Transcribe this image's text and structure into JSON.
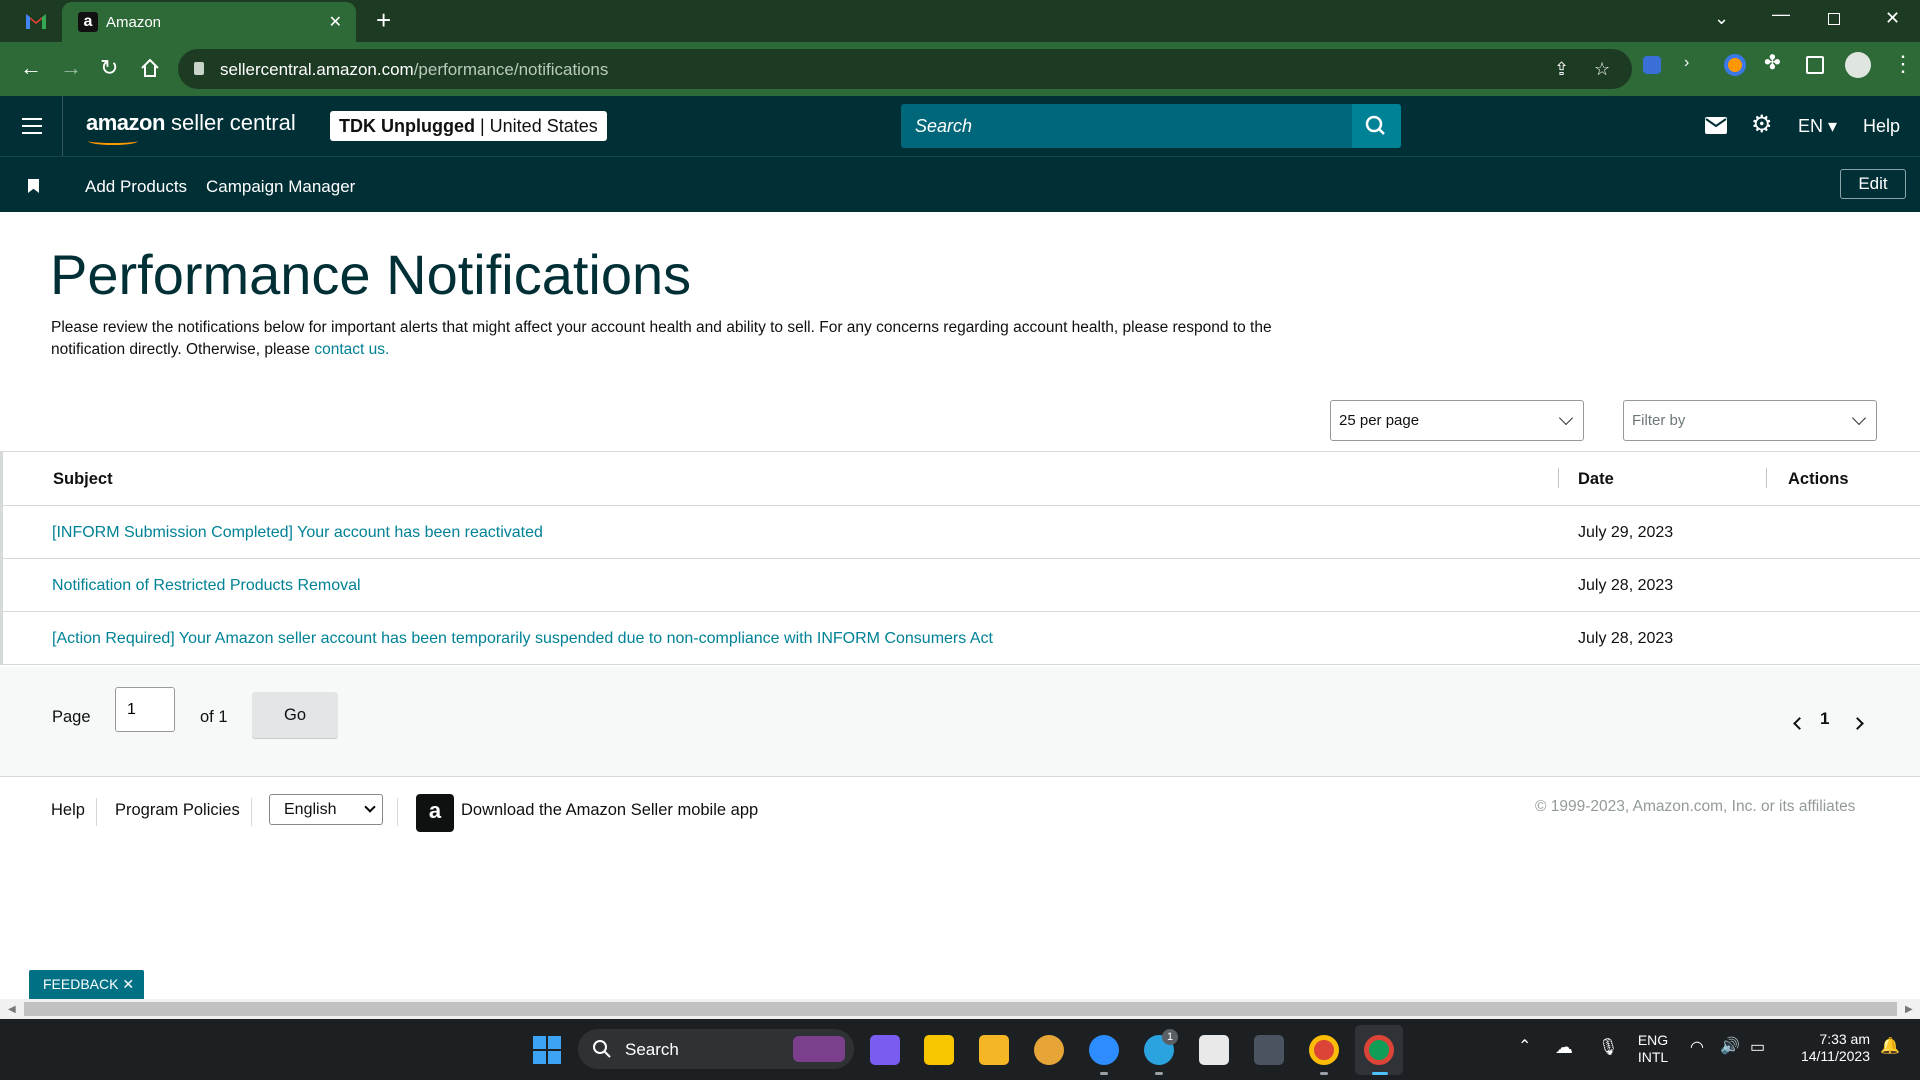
{
  "browser": {
    "tab_title": "Amazon",
    "favicon_letter": "a",
    "url_host": "sellercentral.amazon.com",
    "url_path": "/performance/notifications"
  },
  "header": {
    "logo_bold": "amazon",
    "logo_rest": " seller central",
    "store_name": "TDK Unplugged",
    "marketplace": "| United States",
    "search_placeholder": "Search",
    "language": "EN",
    "help": "Help"
  },
  "subnav": {
    "links": [
      "Add Products",
      "Campaign Manager"
    ],
    "edit_label": "Edit"
  },
  "page": {
    "title": "Performance Notifications",
    "intro_text": "Please review the notifications below for important alerts that might affect your account health and ability to sell. For any concerns regarding account health, please respond to the notification directly. Otherwise, please ",
    "intro_link": "contact us."
  },
  "controls": {
    "per_page": "25 per page",
    "filter_placeholder": "Filter by"
  },
  "table": {
    "columns": [
      "Subject",
      "Date",
      "Actions"
    ],
    "rows": [
      {
        "subject": "[INFORM Submission Completed] Your account has been reactivated",
        "date": "July 29, 2023"
      },
      {
        "subject": "Notification of Restricted Products Removal",
        "date": "July 28, 2023"
      },
      {
        "subject": "[Action Required] Your Amazon seller account has been temporarily suspended due to non-compliance with INFORM Consumers Act",
        "date": "July 28, 2023"
      }
    ]
  },
  "pagination": {
    "page_label": "Page",
    "current_page": "1",
    "of_label": "of 1",
    "go_label": "Go",
    "page_number": "1"
  },
  "footer": {
    "help": "Help",
    "program_policies": "Program Policies",
    "language": "English",
    "app_text": "Download the Amazon Seller mobile app",
    "copyright": "© 1999-2023, Amazon.com, Inc. or its affiliates"
  },
  "feedback_label": "FEEDBACK ✕",
  "taskbar": {
    "search_label": "Search",
    "lang_line1": "ENG",
    "lang_line2": "INTL",
    "time": "7:33 am",
    "date": "14/11/2023",
    "telegram_badge": "1"
  },
  "colors": {
    "header_bg": "#002f36",
    "link": "#008296",
    "browser_frame": "#2d6a37"
  }
}
